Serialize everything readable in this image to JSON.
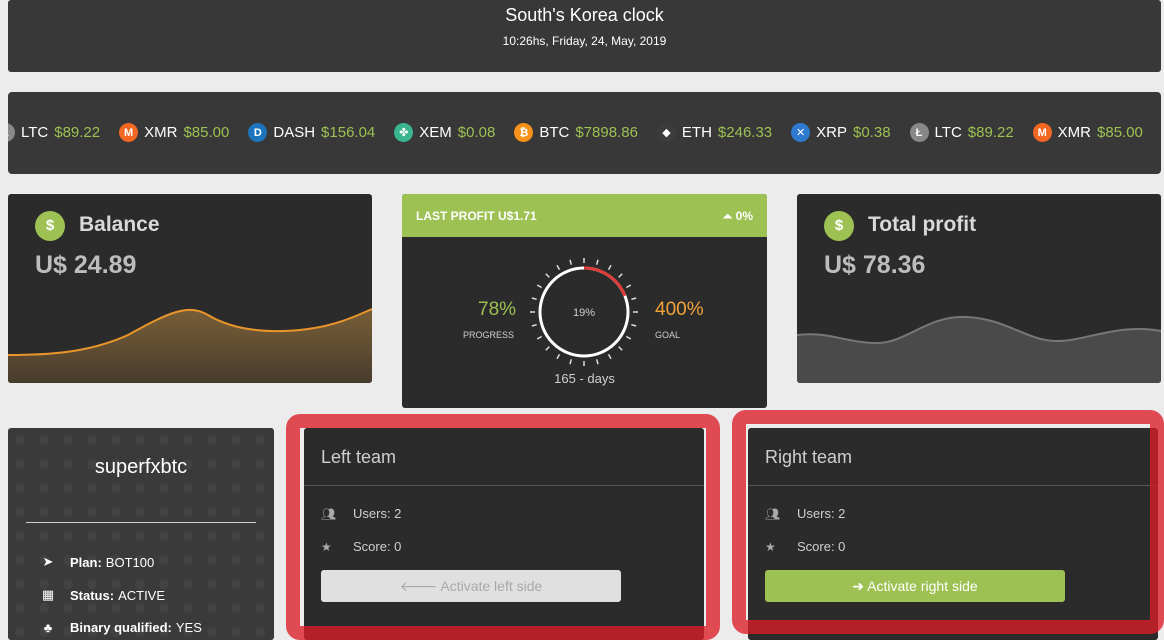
{
  "clock": {
    "title": "South's Korea clock",
    "time": "10:26hs, Friday, 24, May, 2019"
  },
  "ticker": [
    {
      "symbol": "LTC",
      "price": "$89.22",
      "icon": "litecoin-icon",
      "color": "#888888",
      "glyph": "Ł"
    },
    {
      "symbol": "XMR",
      "price": "$85.00",
      "icon": "monero-icon",
      "color": "#f26822",
      "glyph": "M"
    },
    {
      "symbol": "DASH",
      "price": "$156.04",
      "icon": "dash-icon",
      "color": "#1c75bc",
      "glyph": "D"
    },
    {
      "symbol": "XEM",
      "price": "$0.08",
      "icon": "nem-icon",
      "color": "#3bb58f",
      "glyph": "✤"
    },
    {
      "symbol": "BTC",
      "price": "$7898.86",
      "icon": "bitcoin-icon",
      "color": "#f7931a",
      "glyph": "₿"
    },
    {
      "symbol": "ETH",
      "price": "$246.33",
      "icon": "ethereum-icon",
      "color": "#3c3c3d",
      "glyph": "◆"
    },
    {
      "symbol": "XRP",
      "price": "$0.38",
      "icon": "ripple-icon",
      "color": "#2e7ad1",
      "glyph": "✕"
    },
    {
      "symbol": "LTC",
      "price": "$89.22",
      "icon": "litecoin-icon",
      "color": "#888888",
      "glyph": "Ł"
    },
    {
      "symbol": "XMR",
      "price": "$85.00",
      "icon": "monero-icon",
      "color": "#f26822",
      "glyph": "M"
    }
  ],
  "balance": {
    "label": "Balance",
    "amount": "U$ 24.89"
  },
  "total_profit": {
    "label": "Total profit",
    "amount": "U$ 78.36"
  },
  "last_profit": {
    "header": "LAST PROFIT U$1.71",
    "change": "⏶ 0%",
    "progress_value": "78%",
    "progress_label": "PROGRESS",
    "goal_value": "400%",
    "goal_label": "GOAL",
    "gauge_text": "19%",
    "gauge_fraction": 0.19,
    "days": "165 - days"
  },
  "profile": {
    "username": "superfxbtc",
    "plan_label": "Plan:",
    "plan_value": "BOT100",
    "status_label": "Status:",
    "status_value": "ACTIVE",
    "binary_label": "Binary qualified:",
    "binary_value": "YES"
  },
  "left_team": {
    "title": "Left team",
    "users": "Users: 2",
    "score": "Score: 0",
    "button": "Activate left side"
  },
  "right_team": {
    "title": "Right team",
    "users": "Users: 2",
    "score": "Score: 0",
    "button": "Activate right side"
  },
  "colors": {
    "accent_green": "#9dc152",
    "accent_orange": "#f0a43a",
    "annotation_red": "#dc1e28"
  }
}
